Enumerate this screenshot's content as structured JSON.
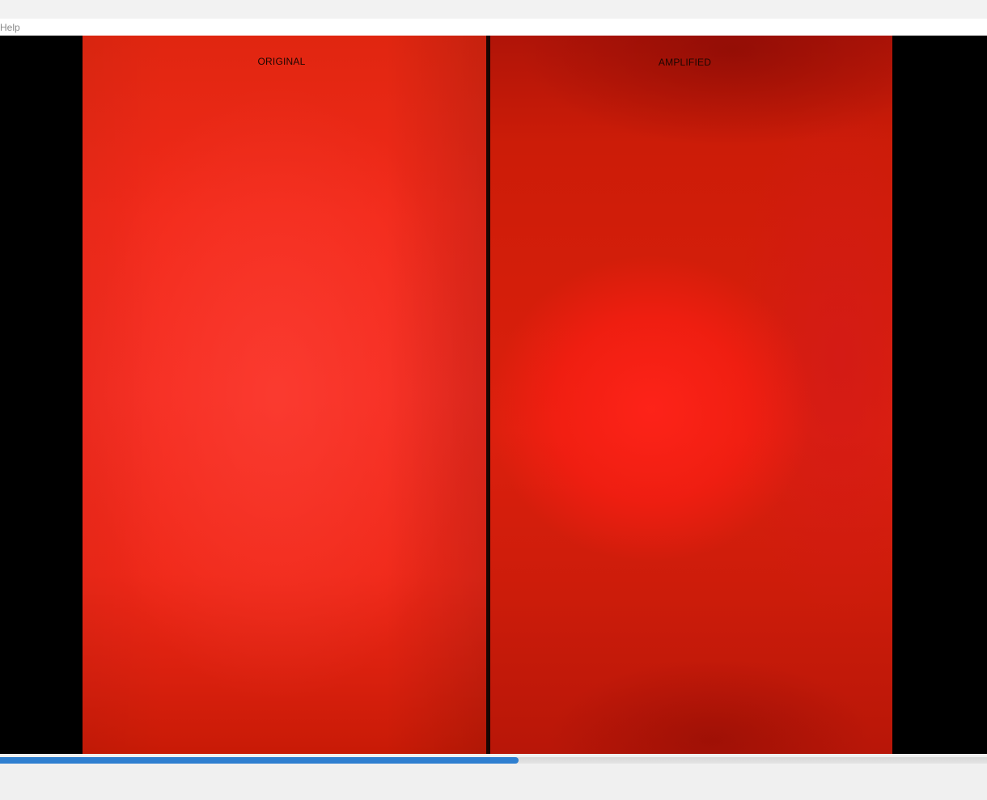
{
  "menu": {
    "items": [
      {
        "label": "Help"
      }
    ]
  },
  "video": {
    "original_label": "ORIGINAL",
    "amplified_label": "AMPLIFIED"
  },
  "playback": {
    "progress_fraction": 0.525,
    "accent_color": "#2f7fd0"
  },
  "colors": {
    "video_background": "#000000",
    "frame_red": "#f22a1a"
  }
}
